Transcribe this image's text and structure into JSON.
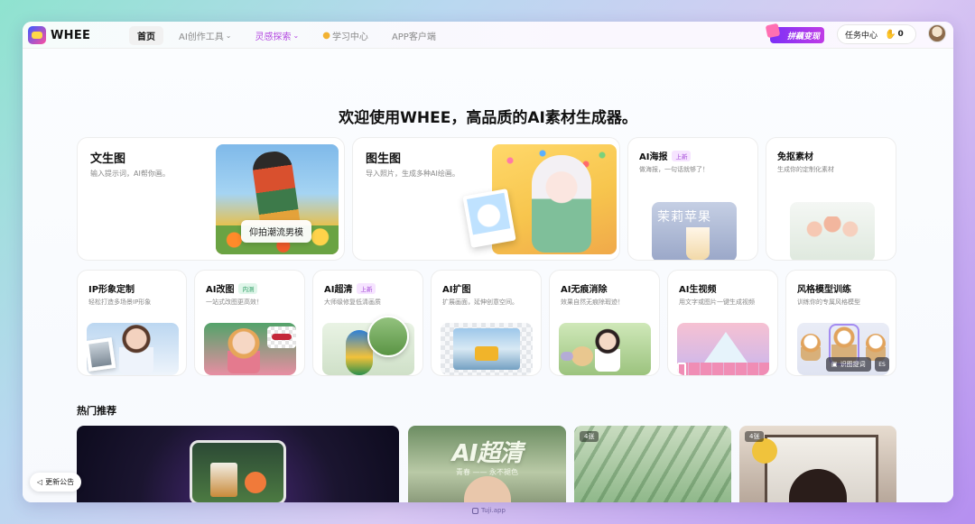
{
  "brand": {
    "name": "WHEE"
  },
  "nav": {
    "home": "首页",
    "ai_tools": "AI创作工具",
    "inspiration": "灵感探索",
    "learning": "学习中心",
    "app": "APP客户端"
  },
  "header": {
    "promo": "拼藕变现",
    "task_center": "任务中心",
    "coins": "0"
  },
  "welcome": "欢迎使用WHEE，高品质的AI素材生成器。",
  "cards_top": [
    {
      "title": "文生图",
      "desc": "输入提示词，AI帮你画。",
      "chip": "仰拍潮流男模"
    },
    {
      "title": "图生图",
      "desc": "导入照片，生成多种AI绘画。"
    },
    {
      "title": "AI海报",
      "tag": "上新",
      "desc": "做海报，一句话就够了！",
      "poster_text": "茉莉苹果"
    },
    {
      "title": "免抠素材",
      "desc": "生成你的定制化素材"
    }
  ],
  "cards_row": [
    {
      "title": "IP形象定制",
      "desc": "轻松打造多场景IP形象"
    },
    {
      "title": "AI改图",
      "tag": "内测",
      "desc": "一站式改图更高效！"
    },
    {
      "title": "AI超清",
      "tag": "上新",
      "desc": "大师级修复低清画质"
    },
    {
      "title": "AI扩图",
      "desc": "扩展画面，延伸创意空间。"
    },
    {
      "title": "AI无痕消除",
      "desc": "效果自然无痕除瑕迹！"
    },
    {
      "title": "AI生视频",
      "desc": "用文字或图片一键生成视频"
    },
    {
      "title": "风格模型训练",
      "desc": "训练你的专属风格模型",
      "recognize": "识图提词",
      "badge": "ES"
    }
  ],
  "recommend": {
    "title": "热门推荐",
    "items": [
      {
        "headline": "AI超清",
        "sub": "青春 —— 永不褪色"
      },
      {
        "count": "4张"
      },
      {
        "count": "4张"
      }
    ]
  },
  "notice": "更新公告",
  "footer": "Tuji.app"
}
